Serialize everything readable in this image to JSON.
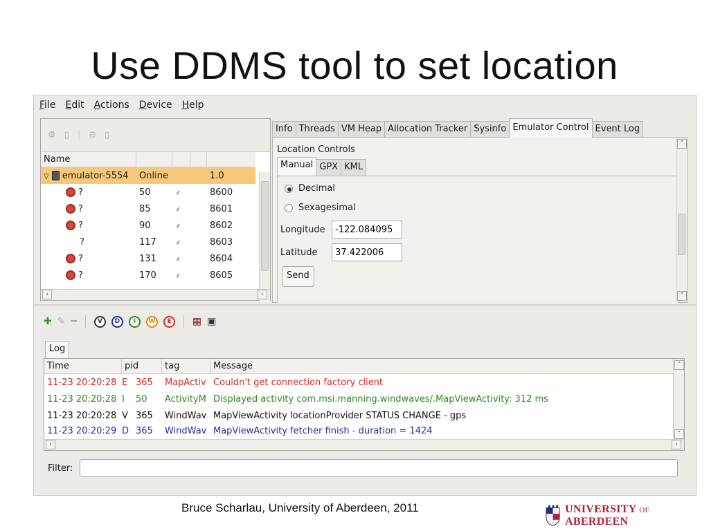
{
  "slide": {
    "title": "Use DDMS tool to set location",
    "credit": "Bruce Scharlau, University of Aberdeen, 2011",
    "logo_main": "UNIVERSITY",
    "logo_of": "OF",
    "logo_place": "ABERDEEN"
  },
  "menu": [
    "File",
    "Edit",
    "Actions",
    "Device",
    "Help"
  ],
  "devices": {
    "columns": [
      "Name",
      "",
      "",
      "",
      ""
    ],
    "rows": [
      {
        "name": "emulator-5554",
        "status": "Online",
        "port": "1.0",
        "selected": true
      },
      {
        "name": "?",
        "status": "50",
        "port": "8600"
      },
      {
        "name": "?",
        "status": "85",
        "port": "8601"
      },
      {
        "name": "?",
        "status": "90",
        "port": "8602"
      },
      {
        "name": "?",
        "status": "117",
        "port": "8603"
      },
      {
        "name": "?",
        "status": "131",
        "port": "8604"
      },
      {
        "name": "?",
        "status": "170",
        "port": "8605"
      }
    ]
  },
  "tabs": [
    "Info",
    "Threads",
    "VM Heap",
    "Allocation Tracker",
    "Sysinfo",
    "Emulator Control",
    "Event Log"
  ],
  "active_tab": "Emulator Control",
  "location": {
    "title": "Location Controls",
    "subtabs": [
      "Manual",
      "GPX",
      "KML"
    ],
    "decimal_label": "Decimal",
    "sexagesimal_label": "Sexagesimal",
    "longitude_label": "Longitude",
    "longitude_value": "-122.084095",
    "latitude_label": "Latitude",
    "latitude_value": "37.422006",
    "send_label": "Send"
  },
  "log": {
    "tab_label": "Log",
    "columns": [
      "Time",
      "",
      "pid",
      "tag",
      "Message"
    ],
    "toolbar_levels": [
      "V",
      "D",
      "I",
      "W",
      "E"
    ],
    "rows": [
      {
        "time": "11-23 20:20:28",
        "level": "E",
        "pid": "365",
        "tag": "MapActiv",
        "message": "Couldn't get connection factory client",
        "color": "#d42a1e"
      },
      {
        "time": "11-23 20:20:28",
        "level": "I",
        "pid": "50",
        "tag": "ActivityM",
        "message": "Displayed activity com.msi.manning.windwaves/.MapViewActivity: 312 ms",
        "color": "#2a8a1e"
      },
      {
        "time": "11-23 20:20:28",
        "level": "V",
        "pid": "365",
        "tag": "WindWav",
        "message": "MapViewActivity   locationProvider STATUS CHANGE - gps",
        "color": "#111111"
      },
      {
        "time": "11-23 20:20:29",
        "level": "D",
        "pid": "365",
        "tag": "WindWav",
        "message": "MapViewActivity fetcher finish - duration = 1424",
        "color": "#1e2ea8"
      }
    ],
    "filter_label": "Filter:"
  }
}
